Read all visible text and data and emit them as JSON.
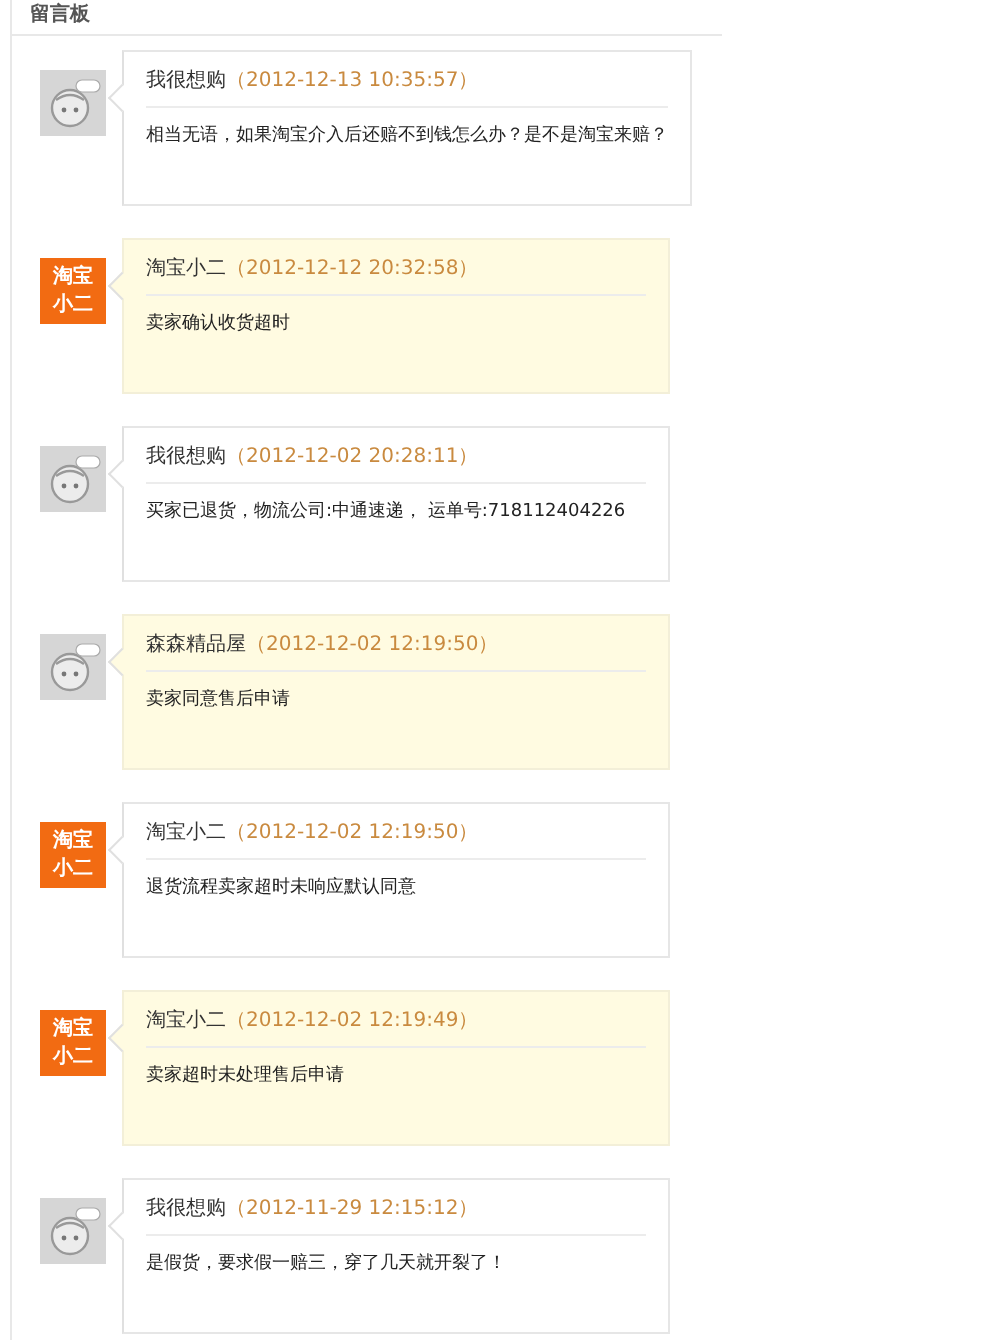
{
  "panel": {
    "title": "留言板"
  },
  "messages": [
    {
      "avatar": {
        "kind": "cartoon"
      },
      "author": "我很想购",
      "time": "（2012-12-13 10:35:57）",
      "text": "相当无语，如果淘宝介入后还赔不到钱怎么办？是不是淘宝来赔？",
      "highlighted": false
    },
    {
      "avatar": {
        "kind": "badge",
        "text": "淘宝小二"
      },
      "author": "淘宝小二",
      "time": "（2012-12-12 20:32:58）",
      "text": "卖家确认收货超时",
      "highlighted": true
    },
    {
      "avatar": {
        "kind": "cartoon"
      },
      "author": "我很想购",
      "time": "（2012-12-02 20:28:11）",
      "text": "买家已退货，物流公司:中通速递， 运单号:718112404226",
      "highlighted": false
    },
    {
      "avatar": {
        "kind": "cartoon"
      },
      "author": "森森精品屋",
      "time": "（2012-12-02 12:19:50）",
      "text": "卖家同意售后申请",
      "highlighted": true
    },
    {
      "avatar": {
        "kind": "badge",
        "text": "淘宝小二"
      },
      "author": "淘宝小二",
      "time": "（2012-12-02 12:19:50）",
      "text": "退货流程卖家超时未响应默认同意",
      "highlighted": false
    },
    {
      "avatar": {
        "kind": "badge",
        "text": "淘宝小二"
      },
      "author": "淘宝小二",
      "time": "（2012-12-02 12:19:49）",
      "text": "卖家超时未处理售后申请",
      "highlighted": true
    },
    {
      "avatar": {
        "kind": "cartoon"
      },
      "author": "我很想购",
      "time": "（2012-11-29 12:15:12）",
      "text": "是假货，要求假一赔三，穿了几天就开裂了！",
      "highlighted": false
    }
  ]
}
